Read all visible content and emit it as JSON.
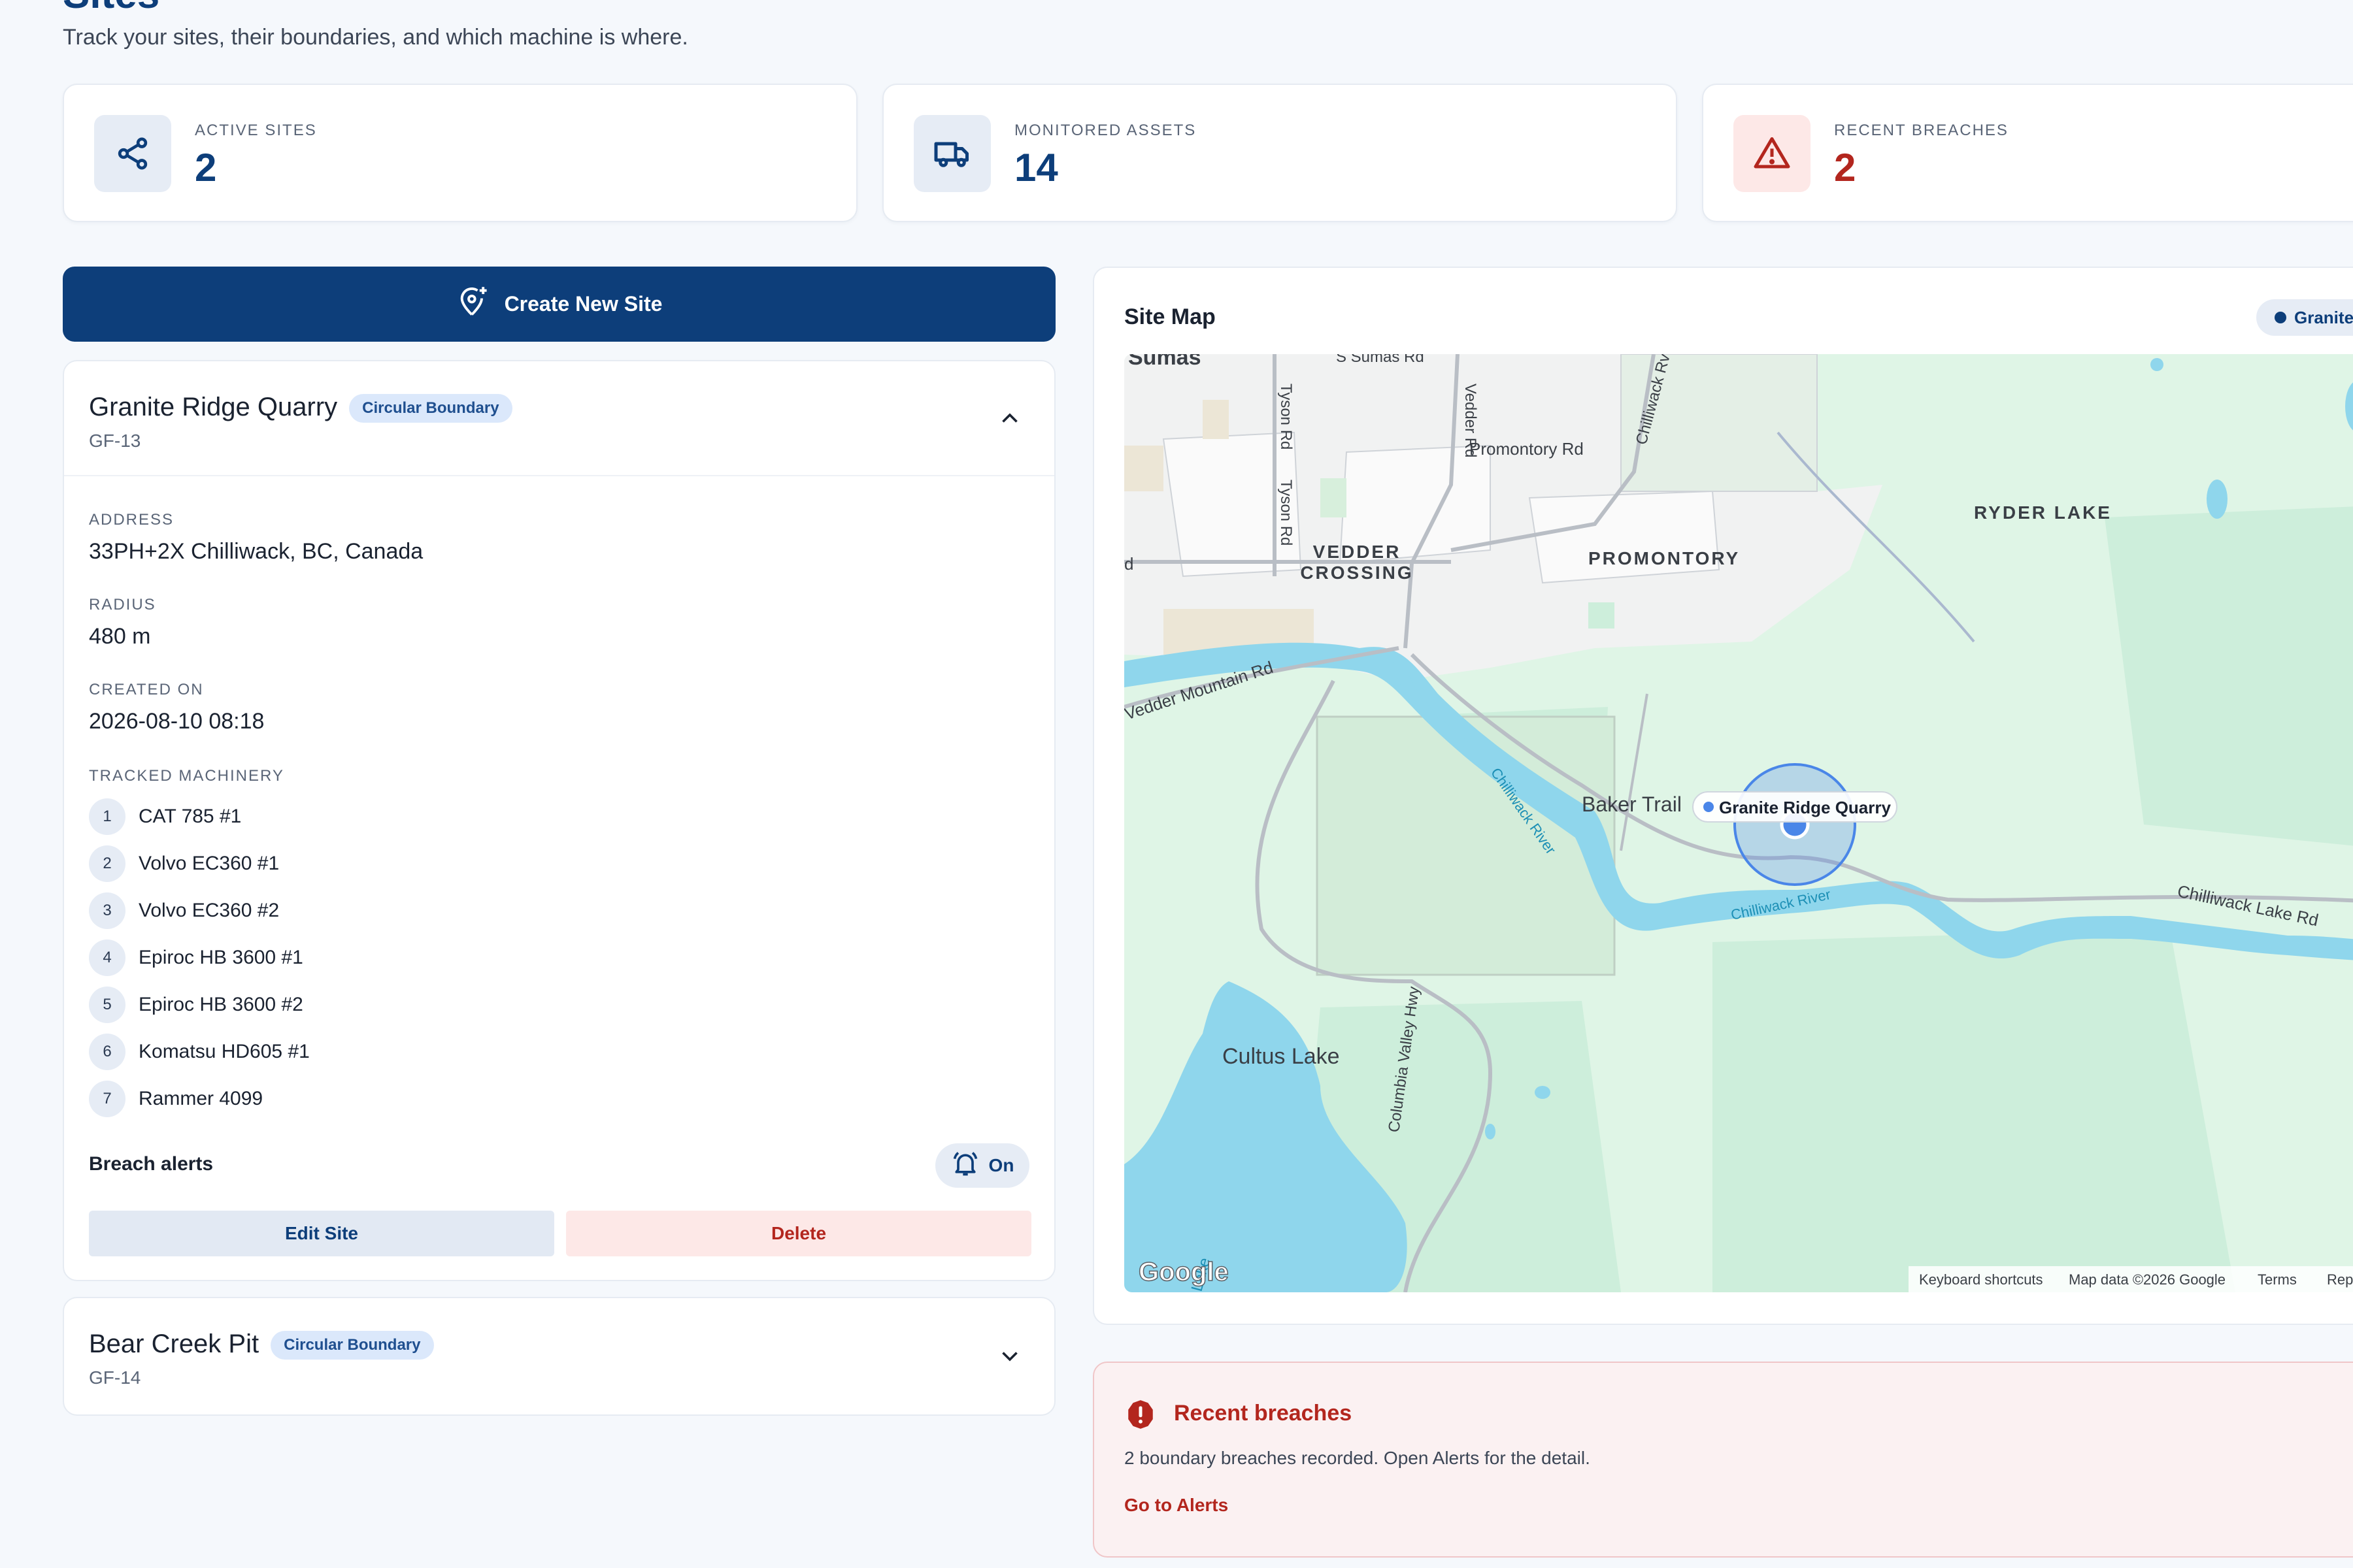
{
  "page": {
    "title": "Sites",
    "subtitle": "Track your sites, their boundaries, and which machine is where."
  },
  "stats": [
    {
      "label": "ACTIVE SITES",
      "value": "2",
      "icon": "network-icon"
    },
    {
      "label": "MONITORED ASSETS",
      "value": "14",
      "icon": "truck-icon"
    },
    {
      "label": "RECENT BREACHES",
      "value": "2",
      "icon": "warning-icon"
    }
  ],
  "create_button": {
    "label": "Create New Site",
    "icon": "add-location-icon"
  },
  "sites": [
    {
      "name": "Granite Ridge Quarry",
      "boundary_type": "Circular Boundary",
      "code": "GF-13",
      "expanded": true,
      "address_label": "ADDRESS",
      "address": "33PH+2X Chilliwack, BC, Canada",
      "radius_label": "RADIUS",
      "radius": "480 m",
      "created_label": "CREATED ON",
      "created": "2026-08-10 08:18",
      "machinery_label": "TRACKED MACHINERY",
      "machinery": [
        {
          "num": "1",
          "name": "CAT 785 #1"
        },
        {
          "num": "2",
          "name": "Volvo EC360 #1"
        },
        {
          "num": "3",
          "name": "Volvo EC360 #2"
        },
        {
          "num": "4",
          "name": "Epiroc HB 3600 #1"
        },
        {
          "num": "5",
          "name": "Epiroc HB 3600 #2"
        },
        {
          "num": "6",
          "name": "Komatsu HD605 #1"
        },
        {
          "num": "7",
          "name": "Rammer 4099"
        }
      ],
      "breach_alerts_label": "Breach alerts",
      "breach_alerts_state": "On",
      "edit_label": "Edit Site",
      "delete_label": "Delete"
    },
    {
      "name": "Bear Creek Pit",
      "boundary_type": "Circular Boundary",
      "code": "GF-14",
      "expanded": false
    }
  ],
  "map": {
    "title": "Site Map",
    "selected_pill": "Granite",
    "marker_label": "Granite Ridge Quarry",
    "place_labels": {
      "sumas": "Sumas",
      "s_sumas_rd": "S Sumas Rd",
      "tyson_rd_a": "Tyson Rd",
      "tyson_rd_b": "Tyson Rd",
      "vedder_rd": "Vedder Rd",
      "chilliwack_rv": "Chilliwack Rv",
      "promontory_rd": "Promontory Rd",
      "vedder_crossing_1": "VEDDER",
      "vedder_crossing_2": "CROSSING",
      "promontory": "PROMONTORY",
      "ryder_lake": "RYDER LAKE",
      "vedder_mountain_rd": "Vedder Mountain Rd",
      "baker_trail": "Baker Trail",
      "chilliwack_river_1": "Chilliwack River",
      "chilliwack_river_2": "Chilliwack River",
      "chilliwack_lake_rd": "Chilliwack Lake Rd",
      "cultus_lake": "Cultus Lake",
      "columbia_valley_hwy": "Columbia Valley Hwy",
      "lake_fragment": "Lake",
      "d_fragment": "d"
    },
    "attribution": {
      "logo": "Google",
      "keyboard": "Keyboard shortcuts",
      "map_data": "Map data ©2026 Google",
      "terms": "Terms",
      "report": "Rep"
    },
    "colors": {
      "land": "#dff5e6",
      "forest": "#cdeedb",
      "water": "#8fd6ec",
      "urban": "#f1f2f2",
      "road": "#b9bec5",
      "geofence": "#4a86e8"
    }
  },
  "breaches": {
    "title": "Recent breaches",
    "text": "2 boundary breaches recorded. Open Alerts for the detail.",
    "link": "Go to Alerts"
  }
}
